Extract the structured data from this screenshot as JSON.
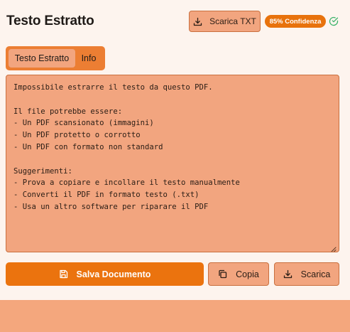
{
  "header": {
    "title": "Testo Estratto",
    "download_txt_label": "Scarica TXT",
    "confidence_badge": "85% Confidenza"
  },
  "tabs": [
    {
      "label": "Testo Estratto",
      "active": true
    },
    {
      "label": "Info",
      "active": false
    }
  ],
  "extracted_text": "Impossibile estrarre il testo da questo PDF.\n\nIl file potrebbe essere:\n- Un PDF scansionato (immagini)\n- Un PDF protetto o corrotto\n- Un PDF con formato non standard\n\nSuggerimenti:\n- Prova a copiare e incollare il testo manualmente\n- Converti il PDF in formato testo (.txt)\n- Usa un altro software per riparare il PDF",
  "actions": {
    "save_label": "Salva Documento",
    "copy_label": "Copia",
    "download_label": "Scarica"
  },
  "icons": {
    "download": "download-icon",
    "check": "check-circle-icon",
    "save": "save-icon",
    "copy": "copy-icon",
    "resize": "resize-handle-icon"
  },
  "colors": {
    "accent": "#eb730e",
    "button_bg": "#f2a57f",
    "page_bg": "#fdf4ee",
    "success": "#3bb36a"
  }
}
